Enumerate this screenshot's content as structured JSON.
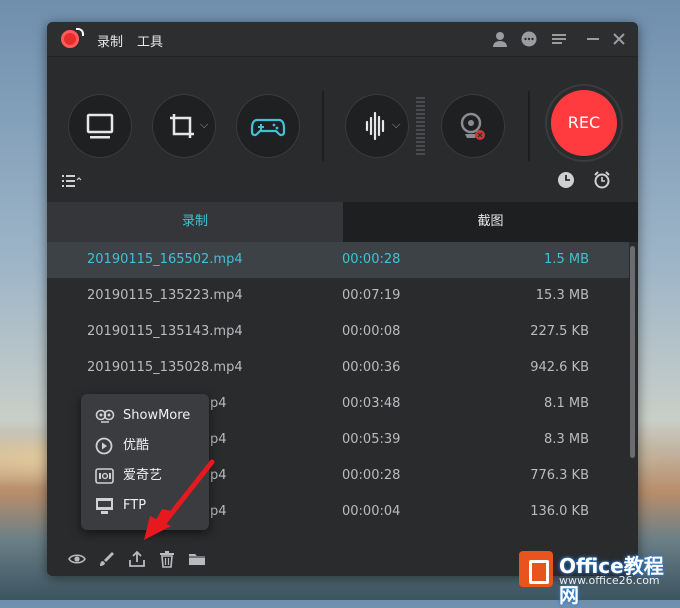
{
  "app": {
    "menu": [
      "录制",
      "工具"
    ],
    "title_icons": [
      "account-icon",
      "chat-icon",
      "menu-icon",
      "minimize-icon",
      "close-icon"
    ]
  },
  "toolbar": {
    "buttons": [
      {
        "name": "screen-mode-icon",
        "has_dropdown": false
      },
      {
        "name": "region-crop-icon",
        "has_dropdown": true
      },
      {
        "name": "game-mode-icon",
        "has_dropdown": false
      },
      {
        "name": "audio-wave-icon",
        "has_dropdown": true
      },
      {
        "name": "webcam-icon",
        "has_dropdown": false
      }
    ],
    "rec_label": "REC",
    "game_icon_color": "#41c1d8",
    "rec_color": "#ff3b3f"
  },
  "tabs": {
    "record": "录制",
    "screenshot": "截图"
  },
  "files": [
    {
      "name": "20190115_165502.mp4",
      "duration": "00:00:28",
      "size": "1.5 MB"
    },
    {
      "name": "20190115_135223.mp4",
      "duration": "00:07:19",
      "size": "15.3 MB"
    },
    {
      "name": "20190115_135143.mp4",
      "duration": "00:00:08",
      "size": "227.5 KB"
    },
    {
      "name": "20190115_135028.mp4",
      "duration": "00:00:36",
      "size": "942.6 KB"
    },
    {
      "name": "20190115_13…mp4",
      "name_visible": "p4",
      "duration": "00:03:48",
      "size": "8.1 MB"
    },
    {
      "name": "20190115_13…mp4",
      "name_visible": "p4",
      "duration": "00:05:39",
      "size": "8.3 MB"
    },
    {
      "name": "20190115_13…mp4",
      "name_visible": "p4",
      "duration": "00:00:28",
      "size": "776.3 KB"
    },
    {
      "name": "20190115_13…mp4",
      "name_visible": "p4",
      "duration": "00:00:04",
      "size": "136.0 KB"
    }
  ],
  "share_menu": [
    {
      "label": "ShowMore",
      "icon": "showmore-icon"
    },
    {
      "label": "优酷",
      "icon": "youku-icon"
    },
    {
      "label": "爱奇艺",
      "icon": "iqiyi-icon"
    },
    {
      "label": "FTP",
      "icon": "ftp-icon"
    }
  ],
  "bottom_icons": [
    "preview-eye-icon",
    "edit-brush-icon",
    "upload-share-icon",
    "delete-trash-icon",
    "open-folder-icon"
  ],
  "watermark": {
    "brand": "Office教程网",
    "url": "www.office26.com"
  }
}
